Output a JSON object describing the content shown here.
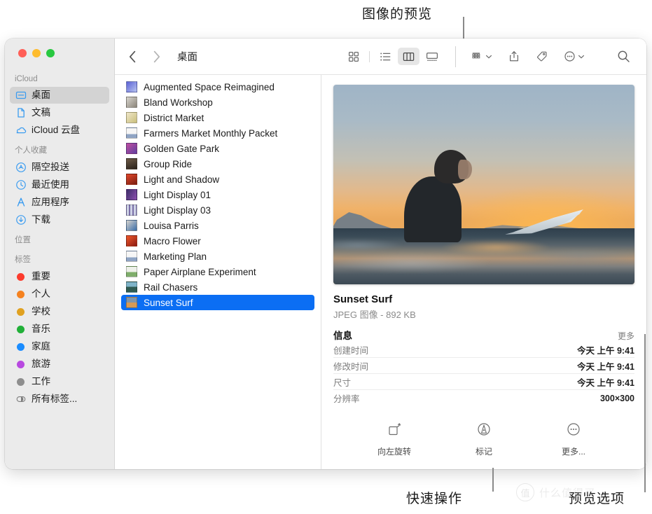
{
  "annotations": [
    {
      "text": "图像的预览"
    },
    {
      "text": "快速操作"
    },
    {
      "text": "预览选项"
    }
  ],
  "watermark": {
    "badge": "值",
    "text": "什么值得买"
  },
  "window": {
    "traffic_lights": [
      "close",
      "minimize",
      "zoom"
    ]
  },
  "sidebar": {
    "groups": [
      {
        "title": "iCloud",
        "items": [
          {
            "label": "桌面",
            "icon": "desktop-icon",
            "selected": true
          },
          {
            "label": "文稿",
            "icon": "document-icon",
            "selected": false
          },
          {
            "label": "iCloud 云盘",
            "icon": "cloud-icon",
            "selected": false
          }
        ]
      },
      {
        "title": "个人收藏",
        "items": [
          {
            "label": "隔空投送",
            "icon": "airdrop-icon",
            "selected": false
          },
          {
            "label": "最近使用",
            "icon": "clock-icon",
            "selected": false
          },
          {
            "label": "应用程序",
            "icon": "applications-icon",
            "selected": false
          },
          {
            "label": "下载",
            "icon": "downloads-icon",
            "selected": false
          }
        ]
      },
      {
        "title": "位置",
        "items": []
      },
      {
        "title": "标签",
        "items": [
          {
            "label": "重要",
            "icon": "tag-dot-icon",
            "color": "#fc3b2d",
            "selected": false
          },
          {
            "label": "个人",
            "icon": "tag-dot-icon",
            "color": "#f5821f",
            "selected": false
          },
          {
            "label": "学校",
            "icon": "tag-dot-icon",
            "color": "#e0a120",
            "selected": false
          },
          {
            "label": "音乐",
            "icon": "tag-dot-icon",
            "color": "#21b038",
            "selected": false
          },
          {
            "label": "家庭",
            "icon": "tag-dot-icon",
            "color": "#1a8cff",
            "selected": false
          },
          {
            "label": "旅游",
            "icon": "tag-dot-icon",
            "color": "#b849e0",
            "selected": false
          },
          {
            "label": "工作",
            "icon": "tag-dot-icon",
            "color": "#8e8e8e",
            "selected": false
          },
          {
            "label": "所有标签...",
            "icon": "all-tags-icon",
            "color": "",
            "selected": false
          }
        ]
      }
    ]
  },
  "toolbar": {
    "back_label": "后退",
    "forward_label": "前进",
    "path_label": "桌面",
    "views": [
      {
        "name": "icon-view",
        "active": false
      },
      {
        "name": "list-view",
        "active": false
      },
      {
        "name": "column-view",
        "active": true
      },
      {
        "name": "gallery-view",
        "active": false
      }
    ],
    "group_label": "分组",
    "share_label": "共享",
    "tags_label": "标签",
    "more_label": "更多",
    "search_label": "搜索"
  },
  "files": [
    {
      "name": "Augmented Space Reimagined",
      "c1": "#5b62d6",
      "c2": "#b7c3ef",
      "selected": false
    },
    {
      "name": "Bland Workshop",
      "c1": "#d8d5ce",
      "c2": "#8b857a",
      "selected": false
    },
    {
      "name": "District Market",
      "c1": "#efe6c9",
      "c2": "#c9bf7c",
      "selected": false
    },
    {
      "name": "Farmers Market Monthly Packet",
      "c1": "#f4f4f4",
      "c2": "#8fa4c4",
      "selected": false
    },
    {
      "name": "Golden Gate Park",
      "c1": "#c04ea0",
      "c2": "#5e3fa0",
      "selected": false
    },
    {
      "name": "Group Ride",
      "c1": "#6d5a46",
      "c2": "#2b231c",
      "selected": false
    },
    {
      "name": "Light and Shadow",
      "c1": "#e2472a",
      "c2": "#7b1f12",
      "selected": false
    },
    {
      "name": "Light Display 01",
      "c1": "#3c2f68",
      "c2": "#8d4fb0",
      "selected": false
    },
    {
      "name": "Light Display 03",
      "c1": "#cfd3e6",
      "c2": "#7a6fa8",
      "selected": false
    },
    {
      "name": "Louisa Parris",
      "c1": "#d7d3cd",
      "c2": "#3b6ea8",
      "selected": false
    },
    {
      "name": "Macro Flower",
      "c1": "#f05a2a",
      "c2": "#8d1a12",
      "selected": false
    },
    {
      "name": "Marketing Plan",
      "c1": "#f4f4f4",
      "c2": "#8fa4c4",
      "selected": false
    },
    {
      "name": "Paper Airplane Experiment",
      "c1": "#eef1ea",
      "c2": "#7fae6b",
      "selected": false
    },
    {
      "name": "Rail Chasers",
      "c1": "#7fb4c9",
      "c2": "#2f5b52",
      "selected": false
    },
    {
      "name": "Sunset Surf",
      "c1": "#7f95ab",
      "c2": "#d79a55",
      "selected": true
    }
  ],
  "preview": {
    "image_alt": "Sunset Surf",
    "title": "Sunset Surf",
    "subtitle": "JPEG 图像 - 892 KB",
    "info_heading": "信息",
    "info_more": "更多",
    "rows": [
      {
        "key": "创建时间",
        "value": "今天 上午 9:41"
      },
      {
        "key": "修改时间",
        "value": "今天 上午 9:41"
      },
      {
        "key": "尺寸",
        "value": "今天 上午 9:41"
      },
      {
        "key": "分辨率",
        "value": "300×300"
      }
    ],
    "quick_actions": [
      {
        "label": "向左旋转",
        "icon": "rotate-left-icon"
      },
      {
        "label": "标记",
        "icon": "markup-icon"
      },
      {
        "label": "更多...",
        "icon": "more-circle-icon"
      }
    ]
  }
}
